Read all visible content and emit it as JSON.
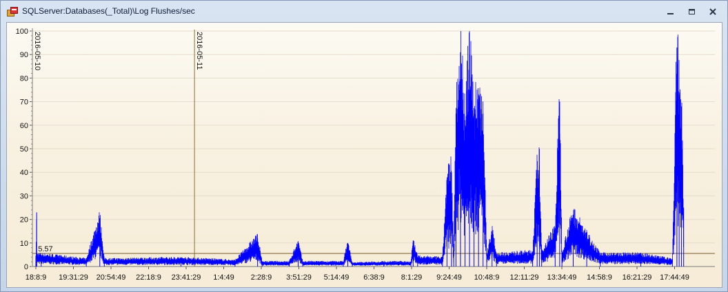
{
  "window": {
    "title": "SQLServer:Databases(_Total)\\Log Flushes/sec",
    "icon": "chart-app-icon",
    "controls": [
      "minimize-icon",
      "restore-icon",
      "close-icon"
    ]
  },
  "colors": {
    "series": "#0000ff",
    "marker_line": "#8b6d2e",
    "grid": "#e4dccb",
    "average_line": "#7a5c2a"
  },
  "chart_data": {
    "type": "line",
    "ylim": [
      0,
      100
    ],
    "yticks": [
      0,
      10,
      20,
      30,
      40,
      50,
      60,
      70,
      80,
      90,
      100
    ],
    "xticks": [
      "18:8:9",
      "19:31:29",
      "20:54:49",
      "22:18:9",
      "23:41:29",
      "1:4:49",
      "2:28:9",
      "3:51:29",
      "5:14:49",
      "6:38:9",
      "8:1:29",
      "9:24:49",
      "10:48:9",
      "12:11:29",
      "13:34:49",
      "14:58:9",
      "16:21:29",
      "17:44:49"
    ],
    "grid": true,
    "date_markers": [
      {
        "label": "2016-05-10",
        "at": "18:8:9"
      },
      {
        "label": "2016-05-11",
        "at": "0:00:00"
      }
    ],
    "average": {
      "label": "5.57",
      "value": 5.57
    },
    "series": [
      {
        "description_points": [
          [
            "18:8:9",
            4
          ],
          [
            "18:10",
            23
          ],
          [
            "18:20",
            5
          ],
          [
            "20:00",
            3
          ],
          [
            "20:30",
            20.5
          ],
          [
            "20:40",
            3
          ],
          [
            "23:30",
            3.5
          ],
          [
            "1:30",
            2.5
          ],
          [
            "2:20",
            12
          ],
          [
            "2:30",
            2
          ],
          [
            "3:30",
            2
          ],
          [
            "3:50",
            10
          ],
          [
            "4:00",
            2
          ],
          [
            "5:30",
            2
          ],
          [
            "5:40",
            10
          ],
          [
            "5:50",
            1.5
          ],
          [
            "7:00",
            2
          ],
          [
            "8:00",
            2
          ],
          [
            "8:05",
            11
          ],
          [
            "8:15",
            4
          ],
          [
            "9:10",
            3.5
          ],
          [
            "9:20",
            36
          ],
          [
            "9:30",
            40
          ],
          [
            "9:35",
            5
          ],
          [
            "9:40",
            65
          ],
          [
            "9:50",
            91
          ],
          [
            "10:00",
            60
          ],
          [
            "10:10",
            90
          ],
          [
            "10:20",
            65
          ],
          [
            "10:30",
            70
          ],
          [
            "10:40",
            65
          ],
          [
            "10:48:9",
            5
          ],
          [
            "11:00",
            15
          ],
          [
            "11:10",
            5
          ],
          [
            "12:30",
            6
          ],
          [
            "12:40",
            41
          ],
          [
            "12:45",
            43
          ],
          [
            "12:50",
            6
          ],
          [
            "13:20",
            16
          ],
          [
            "13:30",
            70
          ],
          [
            "13:35",
            6
          ],
          [
            "14:00",
            22
          ],
          [
            "14:30",
            13
          ],
          [
            "15:00",
            5
          ],
          [
            "16:30",
            5
          ],
          [
            "17:40",
            3
          ],
          [
            "17:50",
            93
          ],
          [
            "17:55",
            73
          ],
          [
            "18:00",
            68
          ],
          [
            "18:05",
            25
          ],
          [
            "18:10",
            5
          ]
        ]
      }
    ]
  }
}
